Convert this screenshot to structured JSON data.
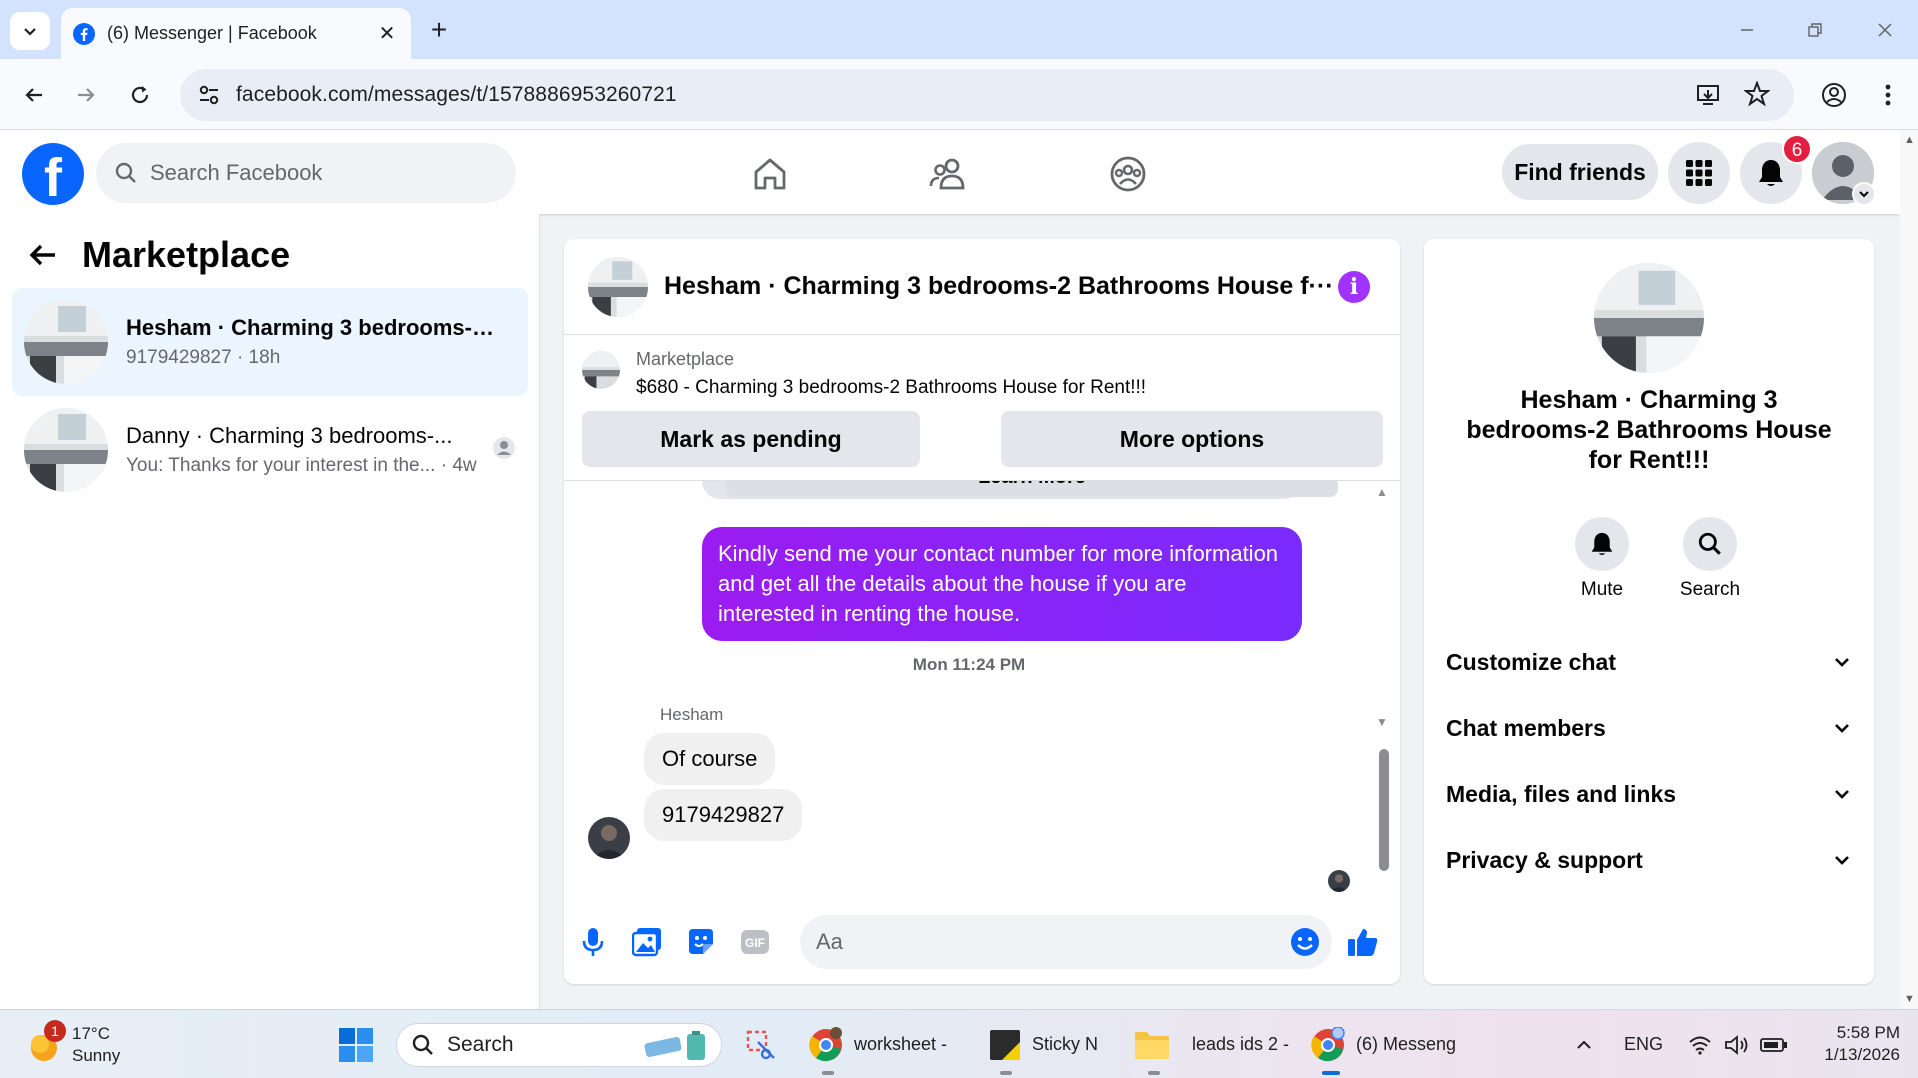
{
  "browser": {
    "tab_title": "(6) Messenger | Facebook",
    "new_tab_symbol": "+",
    "url": "facebook.com/messages/t/1578886953260721"
  },
  "header": {
    "search_placeholder": "Search Facebook",
    "find_friends_label": "Find friends",
    "notification_count": "6"
  },
  "left_panel": {
    "title": "Marketplace",
    "conversations": [
      {
        "name": "Hesham · Charming 3 bedrooms-2...",
        "subtitle": "9179429827 · 18h",
        "active": true
      },
      {
        "name": "Danny · Charming 3 bedrooms-...",
        "subtitle": "You: Thanks for your interest in the... · 4w",
        "active": false
      }
    ]
  },
  "chat": {
    "title": "Hesham · Charming 3 bedrooms-2 Bathrooms House f···",
    "info_symbol": "i",
    "marketplace_label": "Marketplace",
    "listing": "$680 - Charming 3 bedrooms-2 Bathrooms House for Rent!!!",
    "mark_pending_label": "Mark as pending",
    "more_options_label": "More options",
    "learn_more_partial": "Learn More",
    "outgoing_message": "Kindly send me your contact number for more information and get all the details about the house if you are interested in renting the house.",
    "timestamp": "Mon 11:24 PM",
    "sender_name": "Hesham",
    "incoming_messages": [
      "Of course",
      "9179429827"
    ],
    "composer_placeholder": "Aa"
  },
  "right_panel": {
    "name": "Hesham · Charming 3 bedrooms-2 Bathrooms House for Rent!!!",
    "mute_label": "Mute",
    "search_label": "Search",
    "sections": [
      "Customize chat",
      "Chat members",
      "Media, files and links",
      "Privacy & support"
    ]
  },
  "taskbar": {
    "weather_temp": "17°C",
    "weather_desc": "Sunny",
    "weather_badge": "1",
    "search_label": "Search",
    "apps": [
      {
        "label": "worksheet -"
      },
      {
        "label": "Sticky N"
      },
      {
        "label": "leads ids 2 -"
      },
      {
        "label": "(6) Messeng"
      }
    ],
    "language": "ENG",
    "time": "5:58 PM",
    "date": "1/13/2026"
  },
  "colors": {
    "fb_blue": "#0866ff",
    "messenger_purple": "#a033ff",
    "badge_red": "#e41e3f"
  }
}
